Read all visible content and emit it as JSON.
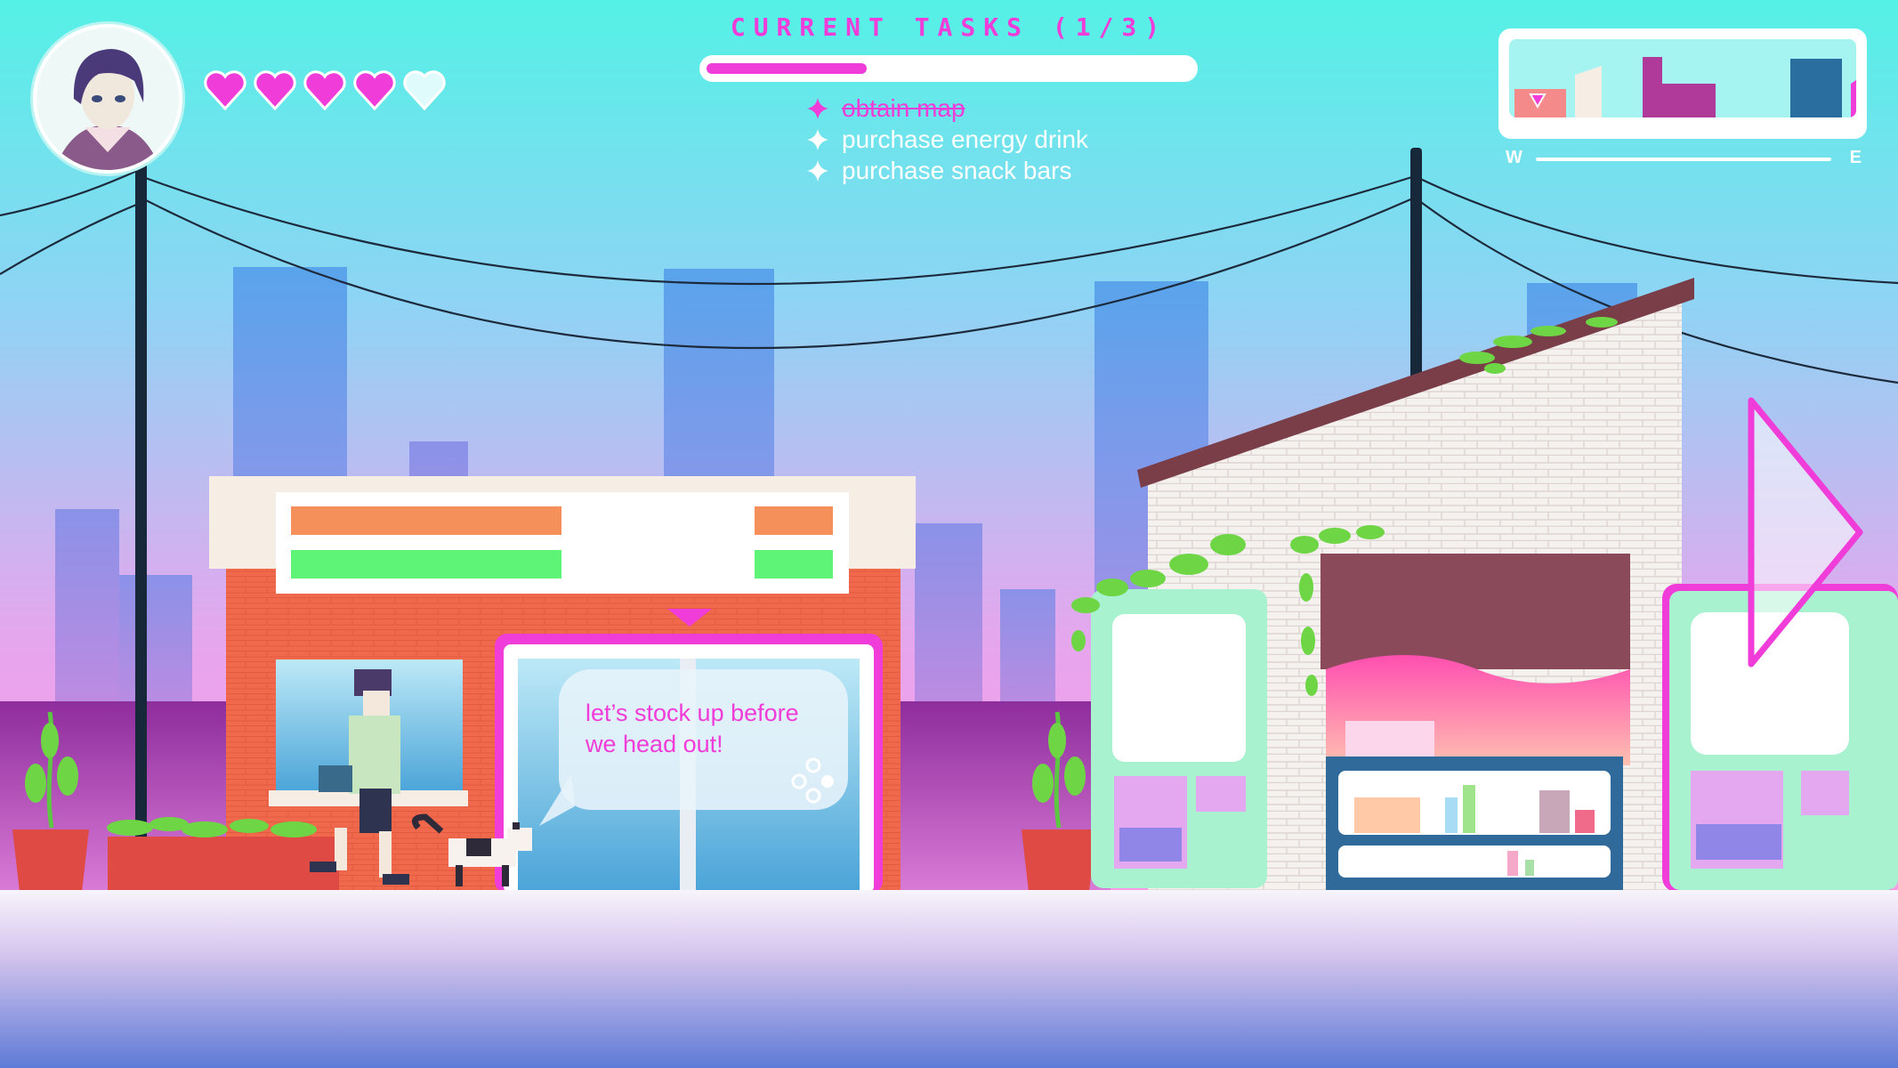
{
  "hud": {
    "portrait": "player-portrait",
    "hearts": {
      "filled": 4,
      "total": 5,
      "filled_color": "#f03cd8",
      "empty_color": "#dffbfb"
    }
  },
  "tasks": {
    "title": "CURRENT TASKS (1/3)",
    "progress": 0.33,
    "items": [
      {
        "label": "obtain map",
        "done": true
      },
      {
        "label": "purchase energy drink",
        "done": false
      },
      {
        "label": "purchase snack bars",
        "done": false
      }
    ]
  },
  "minimap": {
    "west_label": "W",
    "east_label": "E",
    "player_marker": "triangle-down-icon"
  },
  "dialogue": {
    "text": "let’s stock up before we head out!",
    "continue_icon": "dots-icon"
  },
  "navigation": {
    "next_icon": "right-arrow-icon"
  },
  "colors": {
    "accent": "#f03cd8",
    "sky_top": "#5ef0e8",
    "sky_bottom": "#f39ce8",
    "storefront": "#f06a4d",
    "vending": "#a8f2cf"
  }
}
